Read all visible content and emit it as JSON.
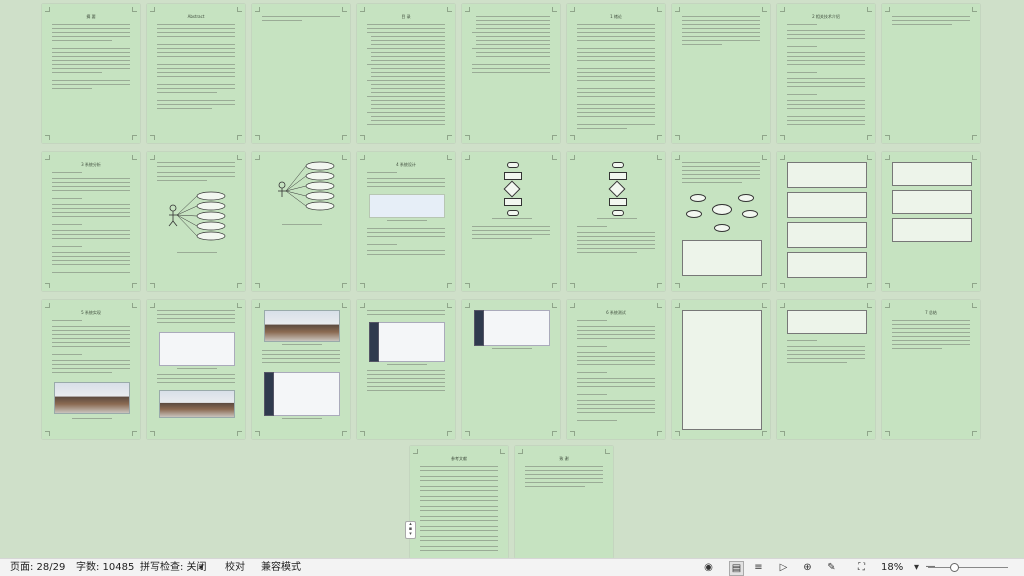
{
  "status": {
    "page": "页面: 28/29",
    "words": "字数: 10485",
    "spell": "拼写检查: 关闭",
    "proof": "校对",
    "compat": "兼容模式",
    "zoom": "18%"
  },
  "pages": {
    "p1_title": "摘 要",
    "p2_title": "Abstract",
    "p4_title": "目 录",
    "p6_title": "1 绪论",
    "p8_title": "2 相关技术介绍",
    "p10_title": "3 系统分析",
    "p13_title": "4 系统设计",
    "p19_title": "5 系统实现",
    "p24_title": "6 系统测试",
    "p27_title": "7 总结",
    "p28_title": "参考文献",
    "p29_title": "致 谢"
  },
  "icons": {
    "eye": "eye-icon",
    "read": "reading-mode-icon",
    "list": "list-icon",
    "play": "play-icon",
    "web": "web-icon",
    "edit": "pen-icon",
    "fit": "fit-page-icon",
    "minus": "zoom-out-icon"
  }
}
